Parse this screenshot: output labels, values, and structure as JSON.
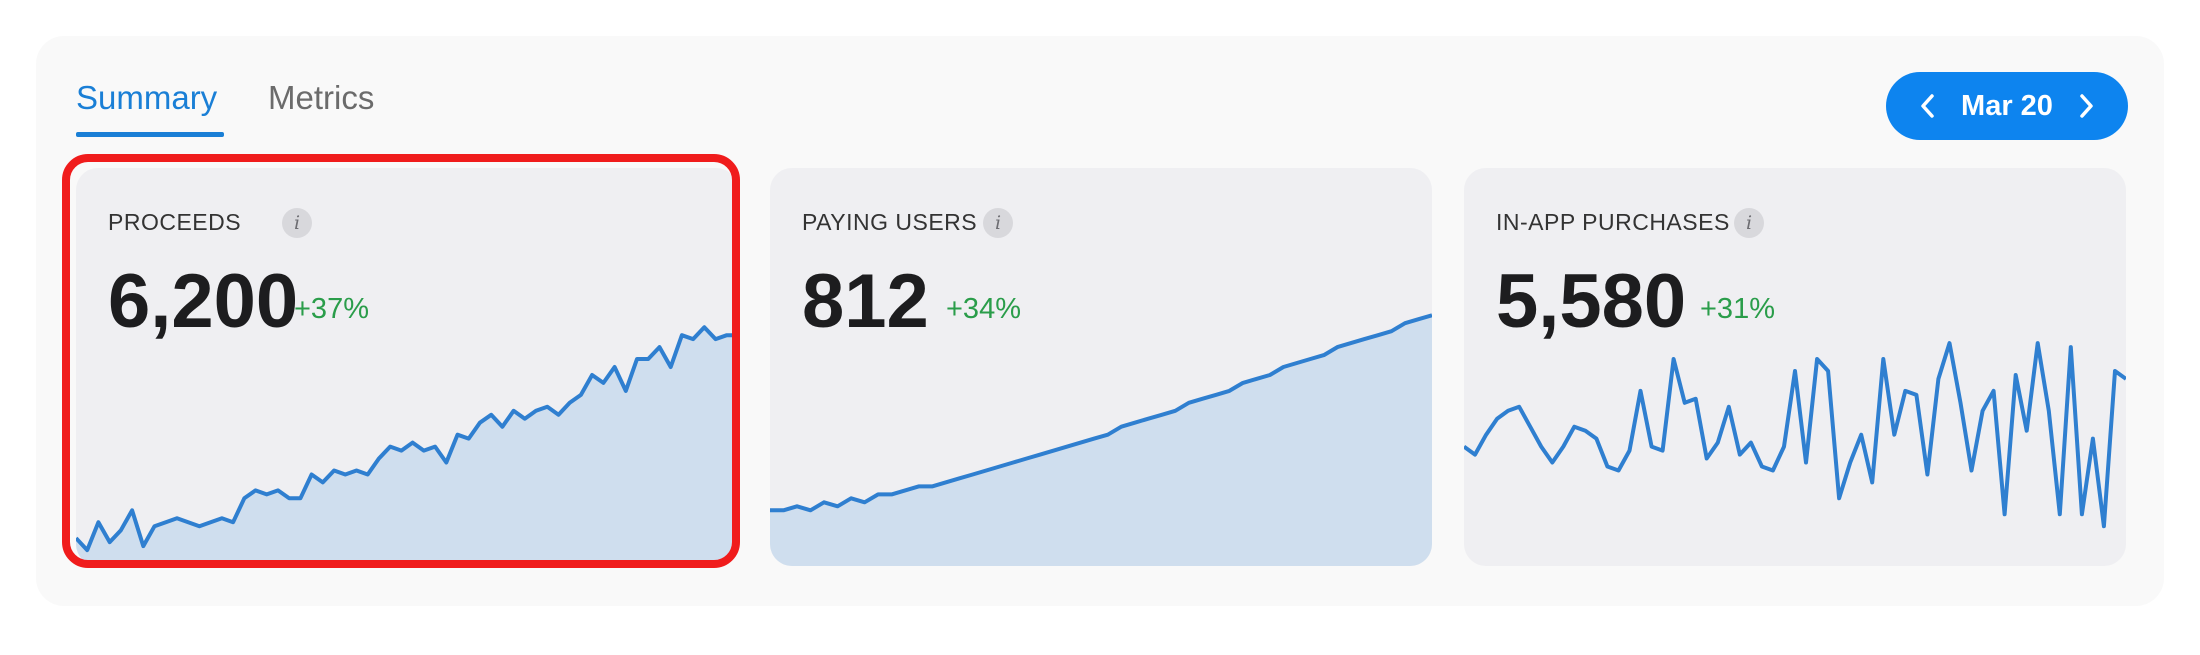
{
  "tabs": {
    "summary_label": "Summary",
    "metrics_label": "Metrics",
    "active": "Summary"
  },
  "date_picker": {
    "label": "Mar 20"
  },
  "colors": {
    "accent": "#0d84ef",
    "positive": "#2a9d4a",
    "chart_line": "#2f7fd0",
    "chart_fill": "#cfdeee",
    "selection": "#f01c1c"
  },
  "cards": [
    {
      "title": "PROCEEDS",
      "value": "6,200",
      "change": "+37%",
      "selected": true,
      "fill": true,
      "series": [
        0.07,
        0.04,
        0.11,
        0.06,
        0.09,
        0.14,
        0.05,
        0.1,
        0.11,
        0.12,
        0.11,
        0.1,
        0.11,
        0.12,
        0.11,
        0.17,
        0.19,
        0.18,
        0.19,
        0.17,
        0.17,
        0.23,
        0.21,
        0.24,
        0.23,
        0.24,
        0.23,
        0.27,
        0.3,
        0.29,
        0.31,
        0.29,
        0.3,
        0.26,
        0.33,
        0.32,
        0.36,
        0.38,
        0.35,
        0.39,
        0.37,
        0.39,
        0.4,
        0.38,
        0.41,
        0.43,
        0.48,
        0.46,
        0.5,
        0.44,
        0.52,
        0.52,
        0.55,
        0.5,
        0.58,
        0.57,
        0.6,
        0.57,
        0.58,
        0.58
      ]
    },
    {
      "title": "PAYING USERS",
      "value": "812",
      "change": "+34%",
      "selected": false,
      "fill": true,
      "series": [
        0.14,
        0.14,
        0.15,
        0.14,
        0.16,
        0.15,
        0.17,
        0.16,
        0.18,
        0.18,
        0.19,
        0.2,
        0.2,
        0.21,
        0.22,
        0.23,
        0.24,
        0.25,
        0.26,
        0.27,
        0.28,
        0.29,
        0.3,
        0.31,
        0.32,
        0.33,
        0.35,
        0.36,
        0.37,
        0.38,
        0.39,
        0.41,
        0.42,
        0.43,
        0.44,
        0.46,
        0.47,
        0.48,
        0.5,
        0.51,
        0.52,
        0.53,
        0.55,
        0.56,
        0.57,
        0.58,
        0.59,
        0.61,
        0.62,
        0.63
      ]
    },
    {
      "title": "IN-APP PURCHASES",
      "value": "5,580",
      "change": "+31%",
      "selected": false,
      "fill": false,
      "series": [
        0.3,
        0.28,
        0.33,
        0.37,
        0.39,
        0.4,
        0.35,
        0.3,
        0.26,
        0.3,
        0.35,
        0.34,
        0.32,
        0.25,
        0.24,
        0.29,
        0.44,
        0.3,
        0.29,
        0.52,
        0.41,
        0.42,
        0.27,
        0.31,
        0.4,
        0.28,
        0.31,
        0.25,
        0.24,
        0.3,
        0.49,
        0.26,
        0.52,
        0.49,
        0.17,
        0.26,
        0.33,
        0.21,
        0.52,
        0.33,
        0.44,
        0.43,
        0.23,
        0.47,
        0.56,
        0.41,
        0.24,
        0.39,
        0.44,
        0.13,
        0.48,
        0.34,
        0.56,
        0.39,
        0.13,
        0.55,
        0.13,
        0.32,
        0.1,
        0.49,
        0.47
      ]
    }
  ]
}
